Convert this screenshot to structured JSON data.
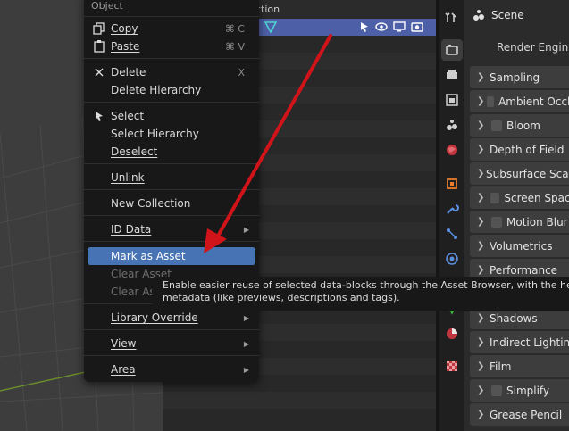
{
  "outliner": {
    "collection_label": "ction"
  },
  "properties": {
    "scene_label": "Scene",
    "render_engine_label": "Render Engine",
    "panels": [
      {
        "label": "Sampling",
        "checkbox": false
      },
      {
        "label": "Ambient Occlu",
        "checkbox": true
      },
      {
        "label": "Bloom",
        "checkbox": true
      },
      {
        "label": "Depth of Field",
        "checkbox": false
      },
      {
        "label": "Subsurface Scatt",
        "checkbox": false
      },
      {
        "label": "Screen Space",
        "checkbox": true
      },
      {
        "label": "Motion Blur",
        "checkbox": true
      },
      {
        "label": "Volumetrics",
        "checkbox": false
      },
      {
        "label": "Performance",
        "checkbox": false
      },
      {
        "label": "Shadows",
        "checkbox": false
      },
      {
        "label": "Indirect Lighting",
        "checkbox": false
      },
      {
        "label": "Film",
        "checkbox": false
      },
      {
        "label": "Simplify",
        "checkbox": true
      },
      {
        "label": "Grease Pencil",
        "checkbox": false
      }
    ]
  },
  "menu": {
    "title": "Object",
    "items": {
      "copy": {
        "label": "Copy",
        "shortcut": "⌘ C"
      },
      "paste": {
        "label": "Paste",
        "shortcut": "⌘ V"
      },
      "delete": {
        "label": "Delete",
        "shortcut": "X"
      },
      "delete_hierarchy": {
        "label": "Delete Hierarchy"
      },
      "select": {
        "label": "Select"
      },
      "select_hierarchy": {
        "label": "Select Hierarchy"
      },
      "deselect": {
        "label": "Deselect"
      },
      "unlink": {
        "label": "Unlink"
      },
      "new_collection": {
        "label": "New Collection"
      },
      "id_data": {
        "label": "ID Data"
      },
      "mark_as_asset": {
        "label": "Mark as Asset"
      },
      "clear_asset": {
        "label": "Clear Asset"
      },
      "clear_asset_2": {
        "label": "Clear As"
      },
      "library_override": {
        "label": "Library Override"
      },
      "view": {
        "label": "View"
      },
      "area": {
        "label": "Area"
      }
    }
  },
  "tooltip": {
    "line1": "Enable easier reuse of selected data-blocks through the Asset Browser, with the help o",
    "line2": "metadata (like previews, descriptions and tags)."
  },
  "colors": {
    "highlight": "#4772b3",
    "selected_row": "#4d5fa6",
    "annotation_arrow": "#d0141a"
  }
}
